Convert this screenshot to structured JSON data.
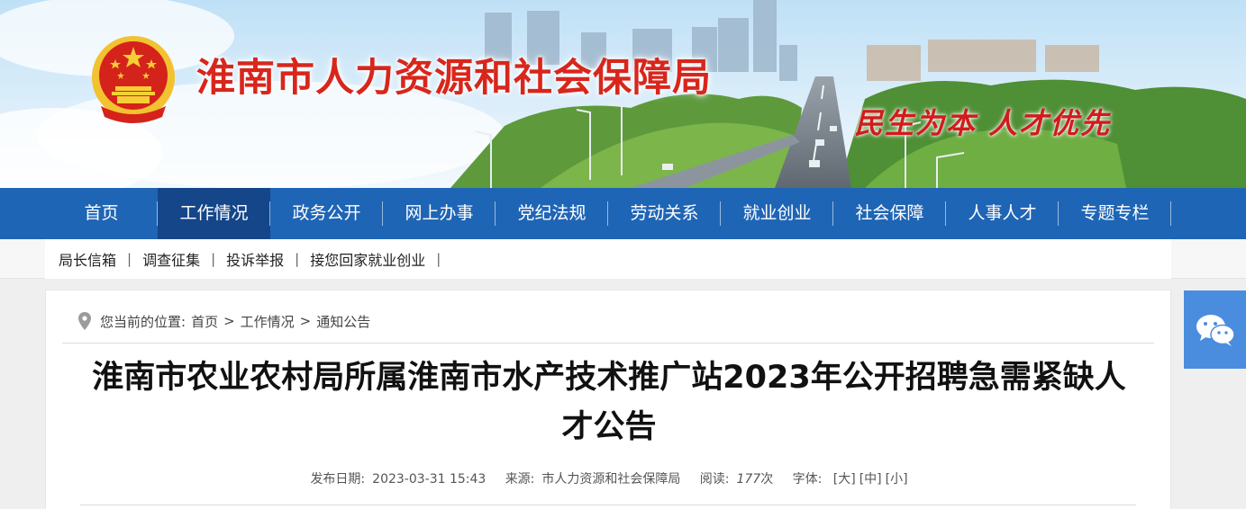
{
  "site": {
    "title": "淮南市人力资源和社会保障局",
    "slogan": "民生为本 人才优先"
  },
  "nav": {
    "items": [
      {
        "label": "首页"
      },
      {
        "label": "工作情况"
      },
      {
        "label": "政务公开"
      },
      {
        "label": "网上办事"
      },
      {
        "label": "党纪法规"
      },
      {
        "label": "劳动关系"
      },
      {
        "label": "就业创业"
      },
      {
        "label": "社会保障"
      },
      {
        "label": "人事人才"
      },
      {
        "label": "专题专栏"
      }
    ],
    "active_index": 1
  },
  "subnav": {
    "items": [
      {
        "label": "局长信箱"
      },
      {
        "label": "调查征集"
      },
      {
        "label": "投诉举报"
      },
      {
        "label": "接您回家就业创业"
      }
    ],
    "separator": "|"
  },
  "breadcrumb": {
    "prefix": "您当前的位置:",
    "items": [
      "首页",
      "工作情况",
      "通知公告"
    ],
    "separator": ">"
  },
  "article": {
    "title": "淮南市农业农村局所属淮南市水产技术推广站2023年公开招聘急需紧缺人才公告",
    "meta": {
      "date_label": "发布日期:",
      "date": "2023-03-31 15:43",
      "source_label": "来源:",
      "source": "市人力资源和社会保障局",
      "views_label": "阅读:",
      "views": "177",
      "views_unit": "次",
      "font_label": "字体:",
      "font_large": "[大]",
      "font_medium": "[中]",
      "font_small": "[小]"
    }
  },
  "icons": {
    "emblem": "national-emblem-icon",
    "location": "location-pin-icon",
    "wechat": "wechat-icon"
  },
  "colors": {
    "nav_bg": "#1f65b5",
    "nav_active": "#15468a",
    "title_red": "#d8261c",
    "wechat_bg": "#4a8ddf"
  }
}
